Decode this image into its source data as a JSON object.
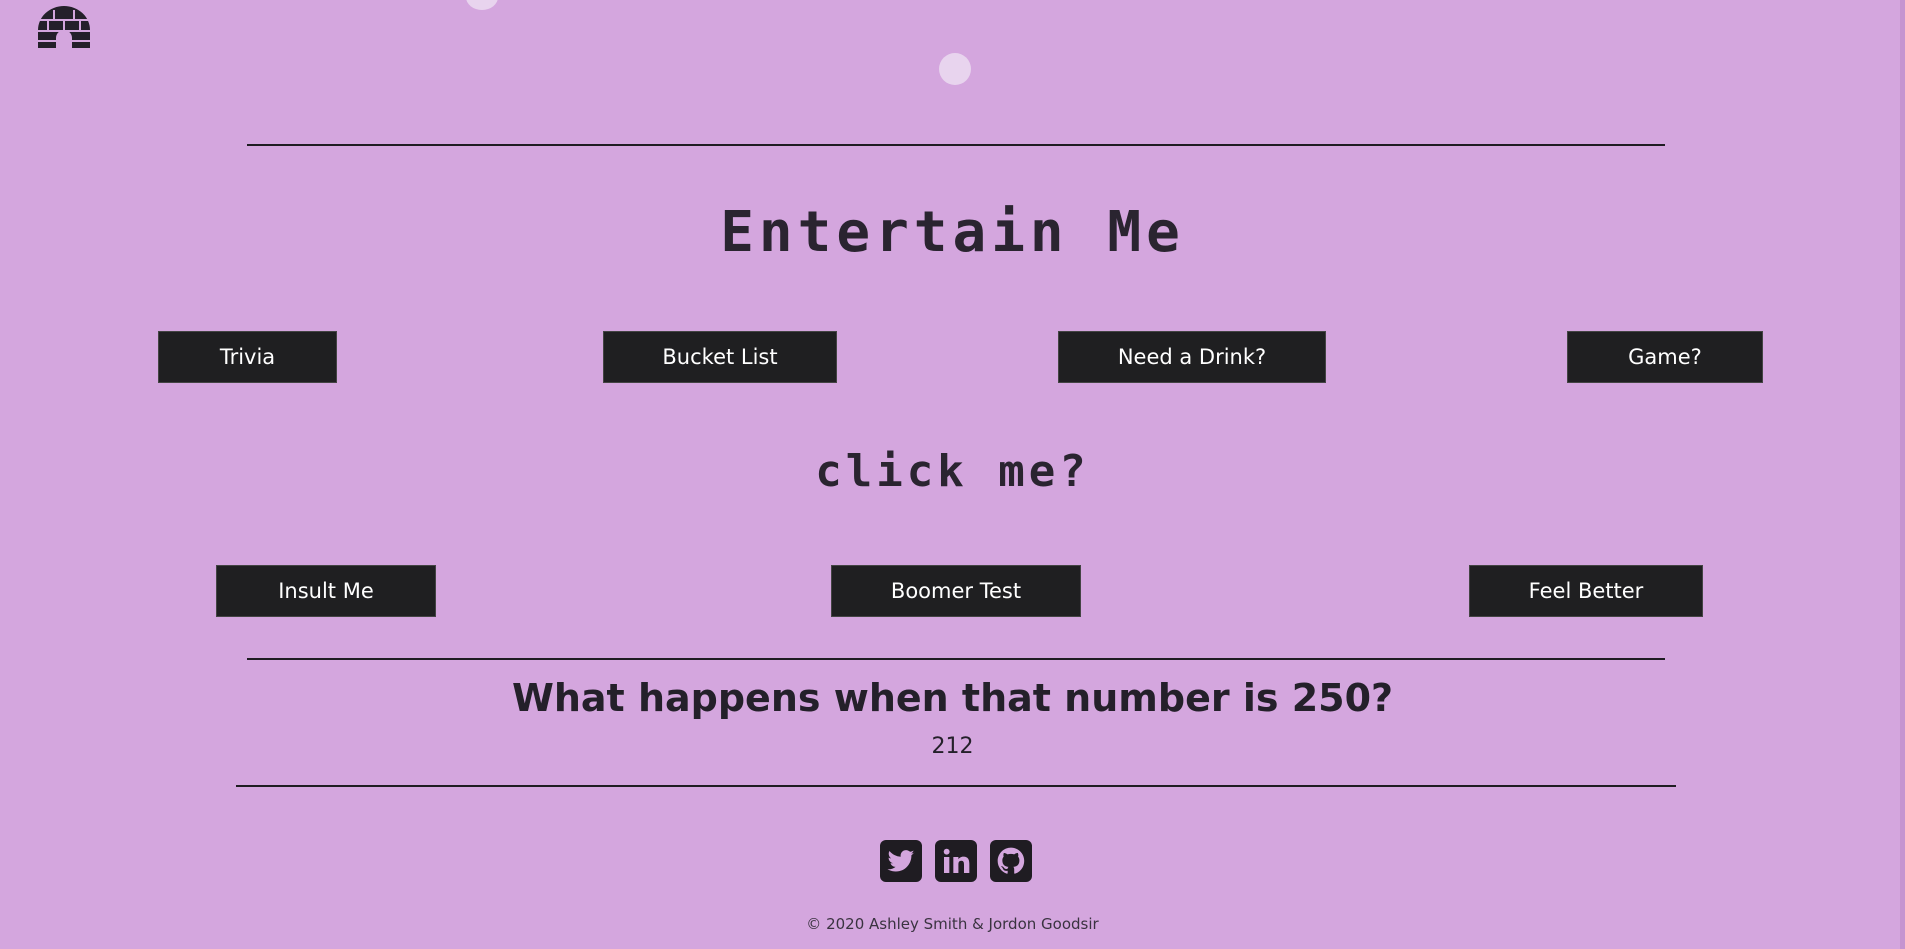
{
  "colors": {
    "background": "#d4a6de",
    "button": "#1f1f21",
    "button_text": "#ffffff",
    "text": "#24202a",
    "bubble": "#e8d4ee"
  },
  "header": {
    "logo_icon": "igloo-icon"
  },
  "main": {
    "title": "Entertain Me",
    "row1_buttons": [
      "Trivia",
      "Bucket List",
      "Need a Drink?",
      "Game?"
    ],
    "subtitle": "click me?",
    "row2_buttons": [
      "Insult Me",
      "Boomer Test",
      "Feel Better"
    ]
  },
  "result": {
    "question": "What happens when that number is 250?",
    "answer": "212"
  },
  "social": {
    "icons": [
      "twitter-icon",
      "linkedin-icon",
      "github-icon"
    ]
  },
  "footer": {
    "copyright": "© 2020 Ashley Smith & Jordon Goodsir"
  }
}
